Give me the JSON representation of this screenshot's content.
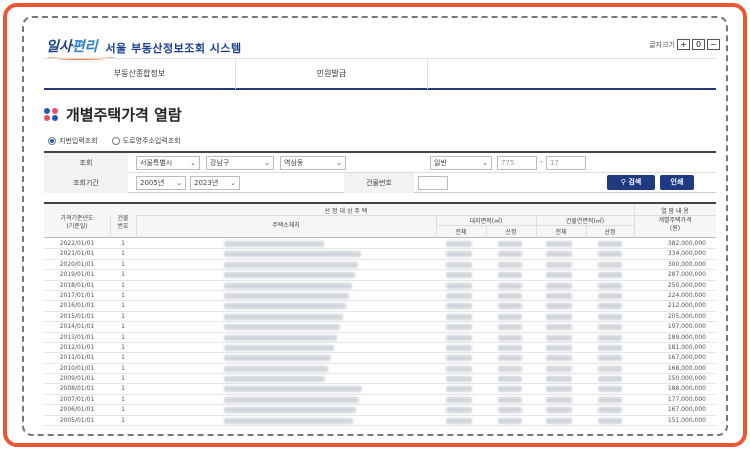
{
  "header": {
    "logo_main": "일사",
    "logo_accent": "편리",
    "site_title": "서울 부동산정보조회 시스템",
    "fontsize_label": "글자크기",
    "fontsize_buttons": [
      "+",
      "0",
      "−"
    ]
  },
  "nav": {
    "items": [
      "부동산종합정보",
      "민원발급"
    ]
  },
  "page": {
    "title": "개별주택가격 열람"
  },
  "radios": [
    {
      "label": "지번입력조회",
      "selected": true
    },
    {
      "label": "도로명주소입력조회",
      "selected": false
    }
  ],
  "search": {
    "label_search": "조회",
    "sido": "서울특별시",
    "sigungu": "강남구",
    "dong": "역삼동",
    "san_type": "일반",
    "bonbun": "775",
    "bubun": "17",
    "label_period": "조회기간",
    "year_from": "2005년",
    "year_to": "2023년",
    "label_building": "건물번호",
    "btn_search": "검색",
    "btn_print": "인쇄",
    "caret": "⌄"
  },
  "table": {
    "header_group_target": "산 정 대 상 주 택",
    "header_group_result": "열 람 내 용",
    "col_date": "가격기준년도\n(기준일)",
    "col_num": "건물\n번호",
    "col_addr": "주택소재지",
    "col_land": "대지면적(㎡)",
    "col_bldg": "건물연면적(㎡)",
    "col_total": "전체",
    "col_calc": "산정",
    "col_total2": "전체",
    "col_calc2": "산정",
    "col_price": "개별주택가격\n(원)",
    "rows": [
      {
        "date": "2022/01/01",
        "num": "1",
        "price": "382,000,000"
      },
      {
        "date": "2021/01/01",
        "num": "1",
        "price": "334,000,000"
      },
      {
        "date": "2020/01/01",
        "num": "1",
        "price": "300,000,000"
      },
      {
        "date": "2019/01/01",
        "num": "1",
        "price": "287,000,000"
      },
      {
        "date": "2018/01/01",
        "num": "1",
        "price": "250,000,000"
      },
      {
        "date": "2017/01/01",
        "num": "1",
        "price": "224,000,000"
      },
      {
        "date": "2016/01/01",
        "num": "1",
        "price": "212,000,000"
      },
      {
        "date": "2015/01/01",
        "num": "1",
        "price": "205,000,000"
      },
      {
        "date": "2014/01/01",
        "num": "1",
        "price": "197,000,000"
      },
      {
        "date": "2013/01/01",
        "num": "1",
        "price": "189,000,000"
      },
      {
        "date": "2012/01/01",
        "num": "1",
        "price": "181,000,000"
      },
      {
        "date": "2011/01/01",
        "num": "1",
        "price": "167,000,000"
      },
      {
        "date": "2010/01/01",
        "num": "1",
        "price": "168,000,000"
      },
      {
        "date": "2009/01/01",
        "num": "1",
        "price": "150,000,000"
      },
      {
        "date": "2008/01/01",
        "num": "1",
        "price": "188,000,000"
      },
      {
        "date": "2007/01/01",
        "num": "1",
        "price": "177,000,000"
      },
      {
        "date": "2006/01/01",
        "num": "1",
        "price": "167,000,000"
      },
      {
        "date": "2005/01/01",
        "num": "1",
        "price": "151,000,000"
      }
    ]
  },
  "colors": {
    "frame": "#ee5533",
    "navy": "#1e3b82",
    "logo_blue": "#1a3f8f"
  }
}
